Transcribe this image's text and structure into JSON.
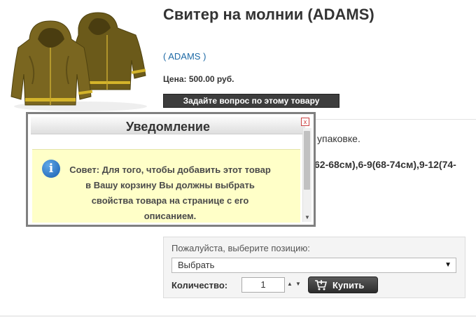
{
  "product": {
    "title": "Свитер на молнии (ADAMS)",
    "manufacturer": "( ADAMS )",
    "price": "Цена: 500.00 руб.",
    "ask_button": "Задайте вопрос по этому товару",
    "description_line1": "упаковке.",
    "description_line2": "62-68см),6-9(68-74см),9-12(74-"
  },
  "modal": {
    "title": "Уведомление",
    "close_symbol": "x",
    "notice": "Совет: Для того, чтобы добавить этот товар в Вашу корзину Вы должны выбрать свойства товара на странице с его описанием."
  },
  "cart": {
    "select_label": "Пожалуйста, выберите позицию:",
    "select_value": "Выбрать",
    "quantity_label": "Количество:",
    "quantity_value": "1",
    "buy_label": "Купить"
  },
  "colors": {
    "link": "#1e6aa6",
    "notice_bg": "#ffffc8",
    "button_dark": "#3d3d3d",
    "sweater": "#6b5a1a",
    "stripe": "#d4b42a"
  },
  "icons": [
    "sweater-image",
    "info-icon",
    "close-icon",
    "cart-icon",
    "chevron-down-icon"
  ]
}
